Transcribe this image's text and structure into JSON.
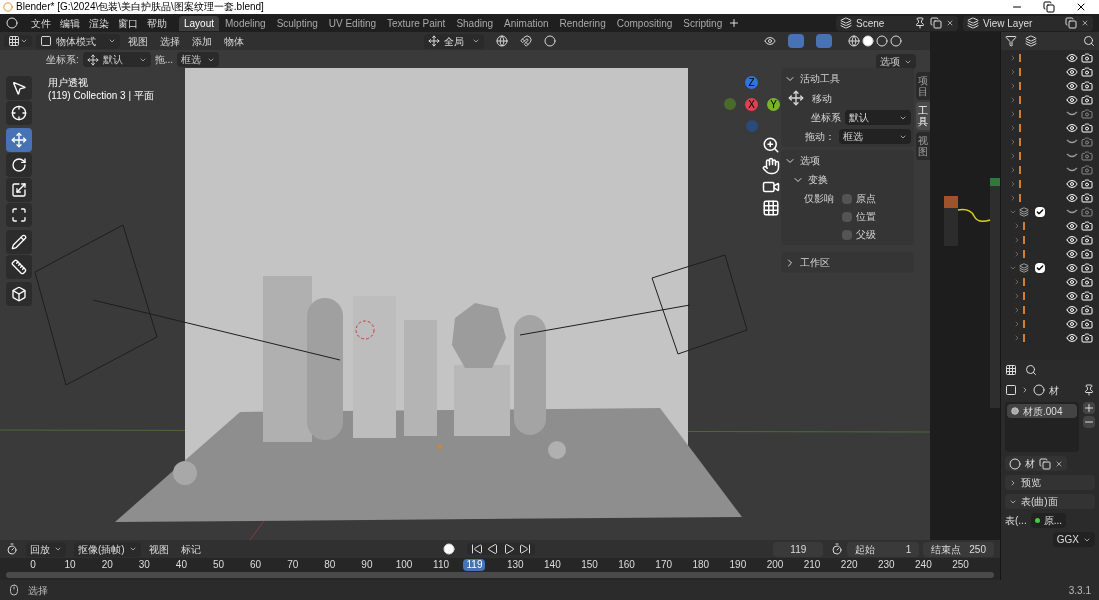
{
  "window": {
    "title": "Blender* [G:\\2024\\包装\\美白护肤品\\图案纹理一套.blend]"
  },
  "menu": [
    "文件",
    "编辑",
    "渲染",
    "窗口",
    "帮助"
  ],
  "workspaces": [
    {
      "label": "Layout",
      "selected": true
    },
    {
      "label": "Modeling",
      "selected": false
    },
    {
      "label": "Sculpting",
      "selected": false
    },
    {
      "label": "UV Editing",
      "selected": false
    },
    {
      "label": "Texture Paint",
      "selected": false
    },
    {
      "label": "Shading",
      "selected": false
    },
    {
      "label": "Animation",
      "selected": false
    },
    {
      "label": "Rendering",
      "selected": false
    },
    {
      "label": "Compositing",
      "selected": false
    },
    {
      "label": "Scripting",
      "selected": false
    }
  ],
  "scene": "Scene",
  "view_layer": "View Layer",
  "viewport": {
    "mode": "物体模式",
    "menus": [
      "视图",
      "选择",
      "添加",
      "物体"
    ],
    "orientation": "全局",
    "options": "选项",
    "tool_settings": {
      "coord_label": "坐标系:",
      "coord_value": "默认",
      "drag_label": "拖...",
      "drag_value": "框选"
    },
    "overlay_lines": [
      "用户透视",
      "(119) Collection 3 | 平面"
    ],
    "tools": [
      {
        "kind": "select",
        "selected": false
      },
      {
        "kind": "cursor",
        "selected": false
      },
      {
        "kind": "move",
        "selected": true
      },
      {
        "kind": "rotate",
        "selected": false
      },
      {
        "kind": "scale",
        "selected": false
      },
      {
        "kind": "transform",
        "selected": false
      },
      {
        "kind": "annotate",
        "selected": false
      },
      {
        "kind": "measure",
        "selected": false
      },
      {
        "kind": "add",
        "selected": false
      }
    ],
    "gizmo": {
      "x": "X",
      "y": "Y",
      "z": "Z"
    },
    "sidebar": {
      "tabs": [
        {
          "label": "项目",
          "selected": false
        },
        {
          "label": "工具",
          "selected": true
        },
        {
          "label": "视图",
          "selected": false
        }
      ],
      "active_tool": {
        "title": "活动工具",
        "expanded": true,
        "tool": "移动",
        "coord_label": "坐标系",
        "coord_value": "默认",
        "drag_label": "拖动：",
        "drag_value": "框选"
      },
      "options": {
        "title": "选项",
        "expanded": true,
        "transform_title": "变换",
        "affect_label": "仅影响",
        "checks": [
          {
            "label": "原点",
            "checked": false
          },
          {
            "label": "位置",
            "checked": false
          },
          {
            "label": "父级",
            "checked": false
          }
        ]
      },
      "workspace": {
        "title": "工作区",
        "expanded": false
      }
    }
  },
  "outliner": {
    "rows": [
      {
        "kind": "object",
        "visible": true
      },
      {
        "kind": "object",
        "visible": true
      },
      {
        "kind": "object",
        "visible": true
      },
      {
        "kind": "object",
        "visible": true
      },
      {
        "kind": "object",
        "visible": false
      },
      {
        "kind": "object",
        "visible": true
      },
      {
        "kind": "object",
        "visible": false
      },
      {
        "kind": "object",
        "visible": false
      },
      {
        "kind": "object",
        "visible": false
      },
      {
        "kind": "object",
        "visible": true
      },
      {
        "kind": "object",
        "visible": true
      },
      {
        "kind": "collection",
        "visible": false,
        "checked": true,
        "children": [
          {
            "kind": "object",
            "visible": true
          },
          {
            "kind": "object",
            "visible": true
          },
          {
            "kind": "object",
            "visible": true
          }
        ]
      },
      {
        "kind": "collection",
        "visible": true,
        "checked": true,
        "children": [
          {
            "kind": "object",
            "visible": true
          },
          {
            "kind": "object",
            "visible": true
          },
          {
            "kind": "object",
            "visible": true
          },
          {
            "kind": "object",
            "visible": true
          },
          {
            "kind": "object",
            "visible": true
          }
        ]
      }
    ]
  },
  "properties": {
    "tab": "材",
    "material": "材质.004",
    "slot_tab": "材",
    "panels": [
      {
        "title": "预览",
        "expanded": false
      },
      {
        "title": "表(曲)面",
        "expanded": true
      }
    ],
    "surface_label": "表(...",
    "surface_value": "原...",
    "distribution": "GGX"
  },
  "timeline": {
    "menus": [
      {
        "label": "回放",
        "kind": "dropdown"
      },
      {
        "label": "抠像(插帧)",
        "kind": "dropdown"
      },
      {
        "label": "视图",
        "kind": "menu"
      },
      {
        "label": "标记",
        "kind": "menu"
      }
    ],
    "current_frame": "119",
    "start_label": "起始",
    "start": "1",
    "end_label": "结束点",
    "end": "250",
    "ruler": [
      {
        "label": "0",
        "selected": false
      },
      {
        "label": "10",
        "selected": false
      },
      {
        "label": "20",
        "selected": false
      },
      {
        "label": "30",
        "selected": false
      },
      {
        "label": "40",
        "selected": false
      },
      {
        "label": "50",
        "selected": false
      },
      {
        "label": "60",
        "selected": false
      },
      {
        "label": "70",
        "selected": false
      },
      {
        "label": "80",
        "selected": false
      },
      {
        "label": "90",
        "selected": false
      },
      {
        "label": "100",
        "selected": false
      },
      {
        "label": "110",
        "selected": false
      },
      {
        "label": "119",
        "selected": true
      },
      {
        "label": "130",
        "selected": false
      },
      {
        "label": "140",
        "selected": false
      },
      {
        "label": "150",
        "selected": false
      },
      {
        "label": "160",
        "selected": false
      },
      {
        "label": "170",
        "selected": false
      },
      {
        "label": "180",
        "selected": false
      },
      {
        "label": "190",
        "selected": false
      },
      {
        "label": "200",
        "selected": false
      },
      {
        "label": "210",
        "selected": false
      },
      {
        "label": "220",
        "selected": false
      },
      {
        "label": "230",
        "selected": false
      },
      {
        "label": "240",
        "selected": false
      },
      {
        "label": "250",
        "selected": false
      }
    ]
  },
  "status_bar": {
    "hint": "选择",
    "version": "3.3.1"
  }
}
